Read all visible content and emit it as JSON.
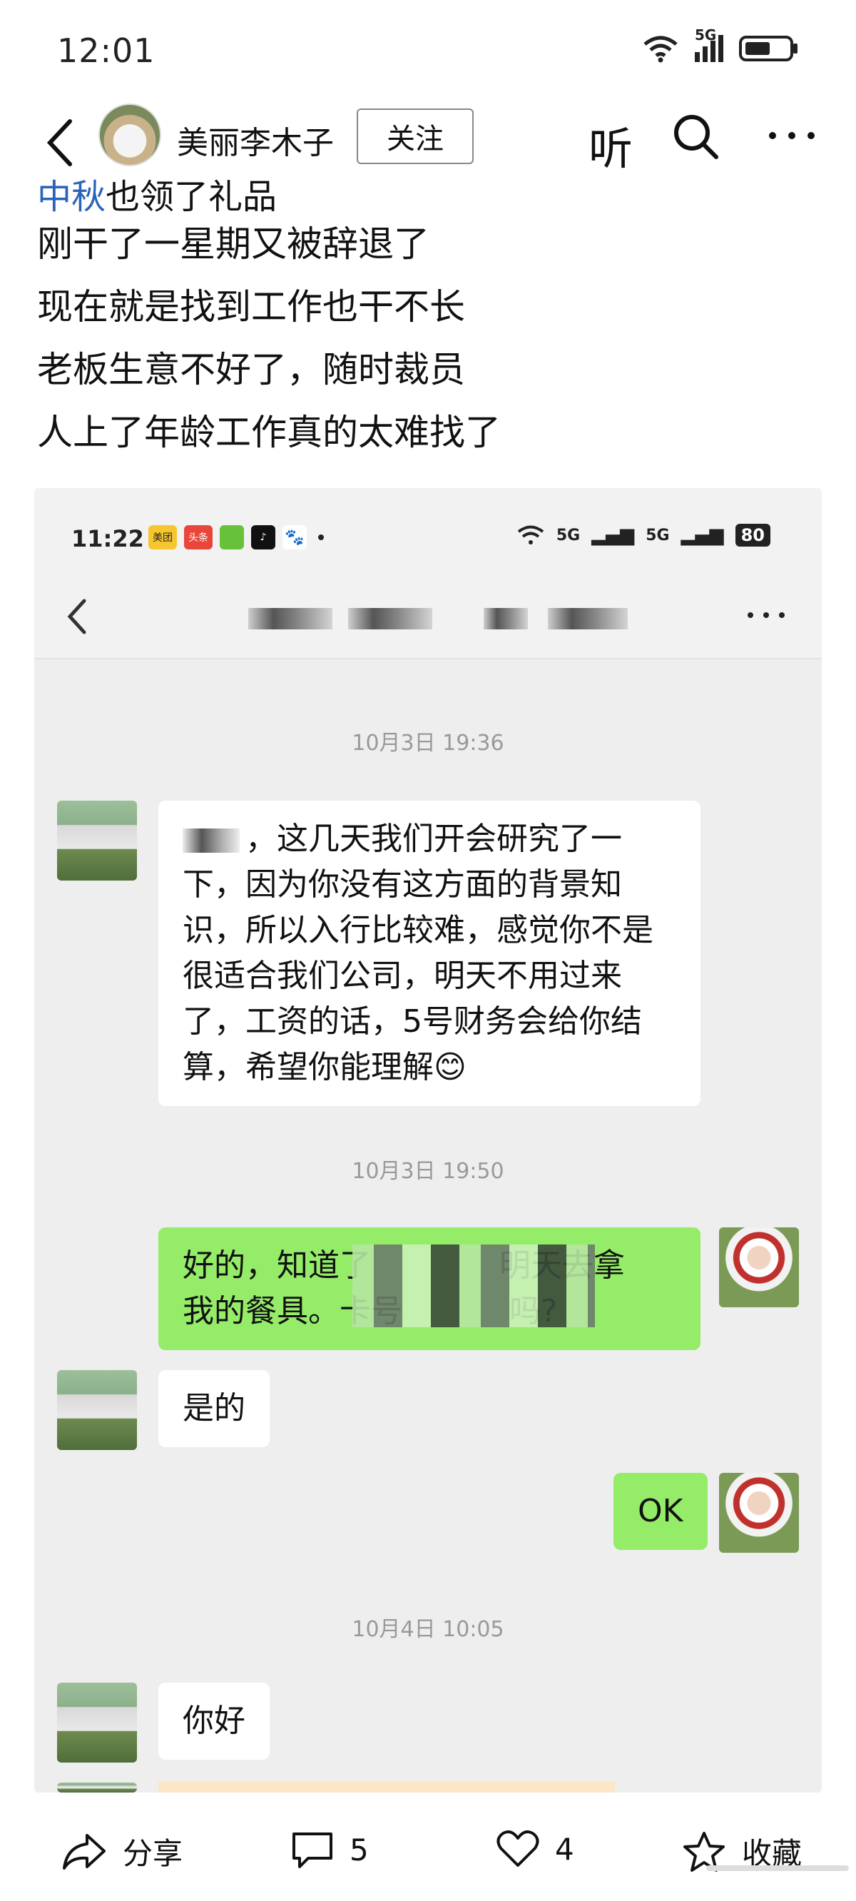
{
  "status_bar": {
    "time": "12:01",
    "network": "5G"
  },
  "header": {
    "author": "美丽李木子",
    "follow_label": "关注",
    "listen_label": "听"
  },
  "post": {
    "partial_line_highlight": "中秋",
    "partial_line_rest": "也领了礼品",
    "lines": [
      "刚干了一星期又被辞退了",
      "现在就是找到工作也干不长",
      "老板生意不好了，随时裁员",
      "人上了年龄工作真的太难找了"
    ]
  },
  "screenshot": {
    "status": {
      "time": "11:22",
      "app_badges": [
        "美团",
        "头条"
      ],
      "signal1": "5G",
      "signal2": "5G",
      "battery": "80"
    },
    "timestamps": [
      "10月3日 19:36",
      "10月3日 19:50",
      "10月4日 10:05"
    ],
    "messages": [
      {
        "side": "left",
        "text": "，这几天我们开会研究了一下，因为你没有这方面的背景知识，所以入行比较难，感觉你不是很适合我们公司，明天不用过来了，工资的话，5号财务会给你结算，希望你能理解😊"
      },
      {
        "side": "right",
        "text_a": "好的，知道了",
        "text_b": "明天去拿",
        "text_c": "我的餐具。卡号",
        "text_d": "吗?"
      },
      {
        "side": "left",
        "text": "是的"
      },
      {
        "side": "right",
        "text": "OK"
      },
      {
        "side": "left",
        "text": "你好"
      }
    ]
  },
  "bottom_bar": {
    "share_label": "分享",
    "comment_count": "5",
    "like_count": "4",
    "favorite_label": "收藏"
  }
}
